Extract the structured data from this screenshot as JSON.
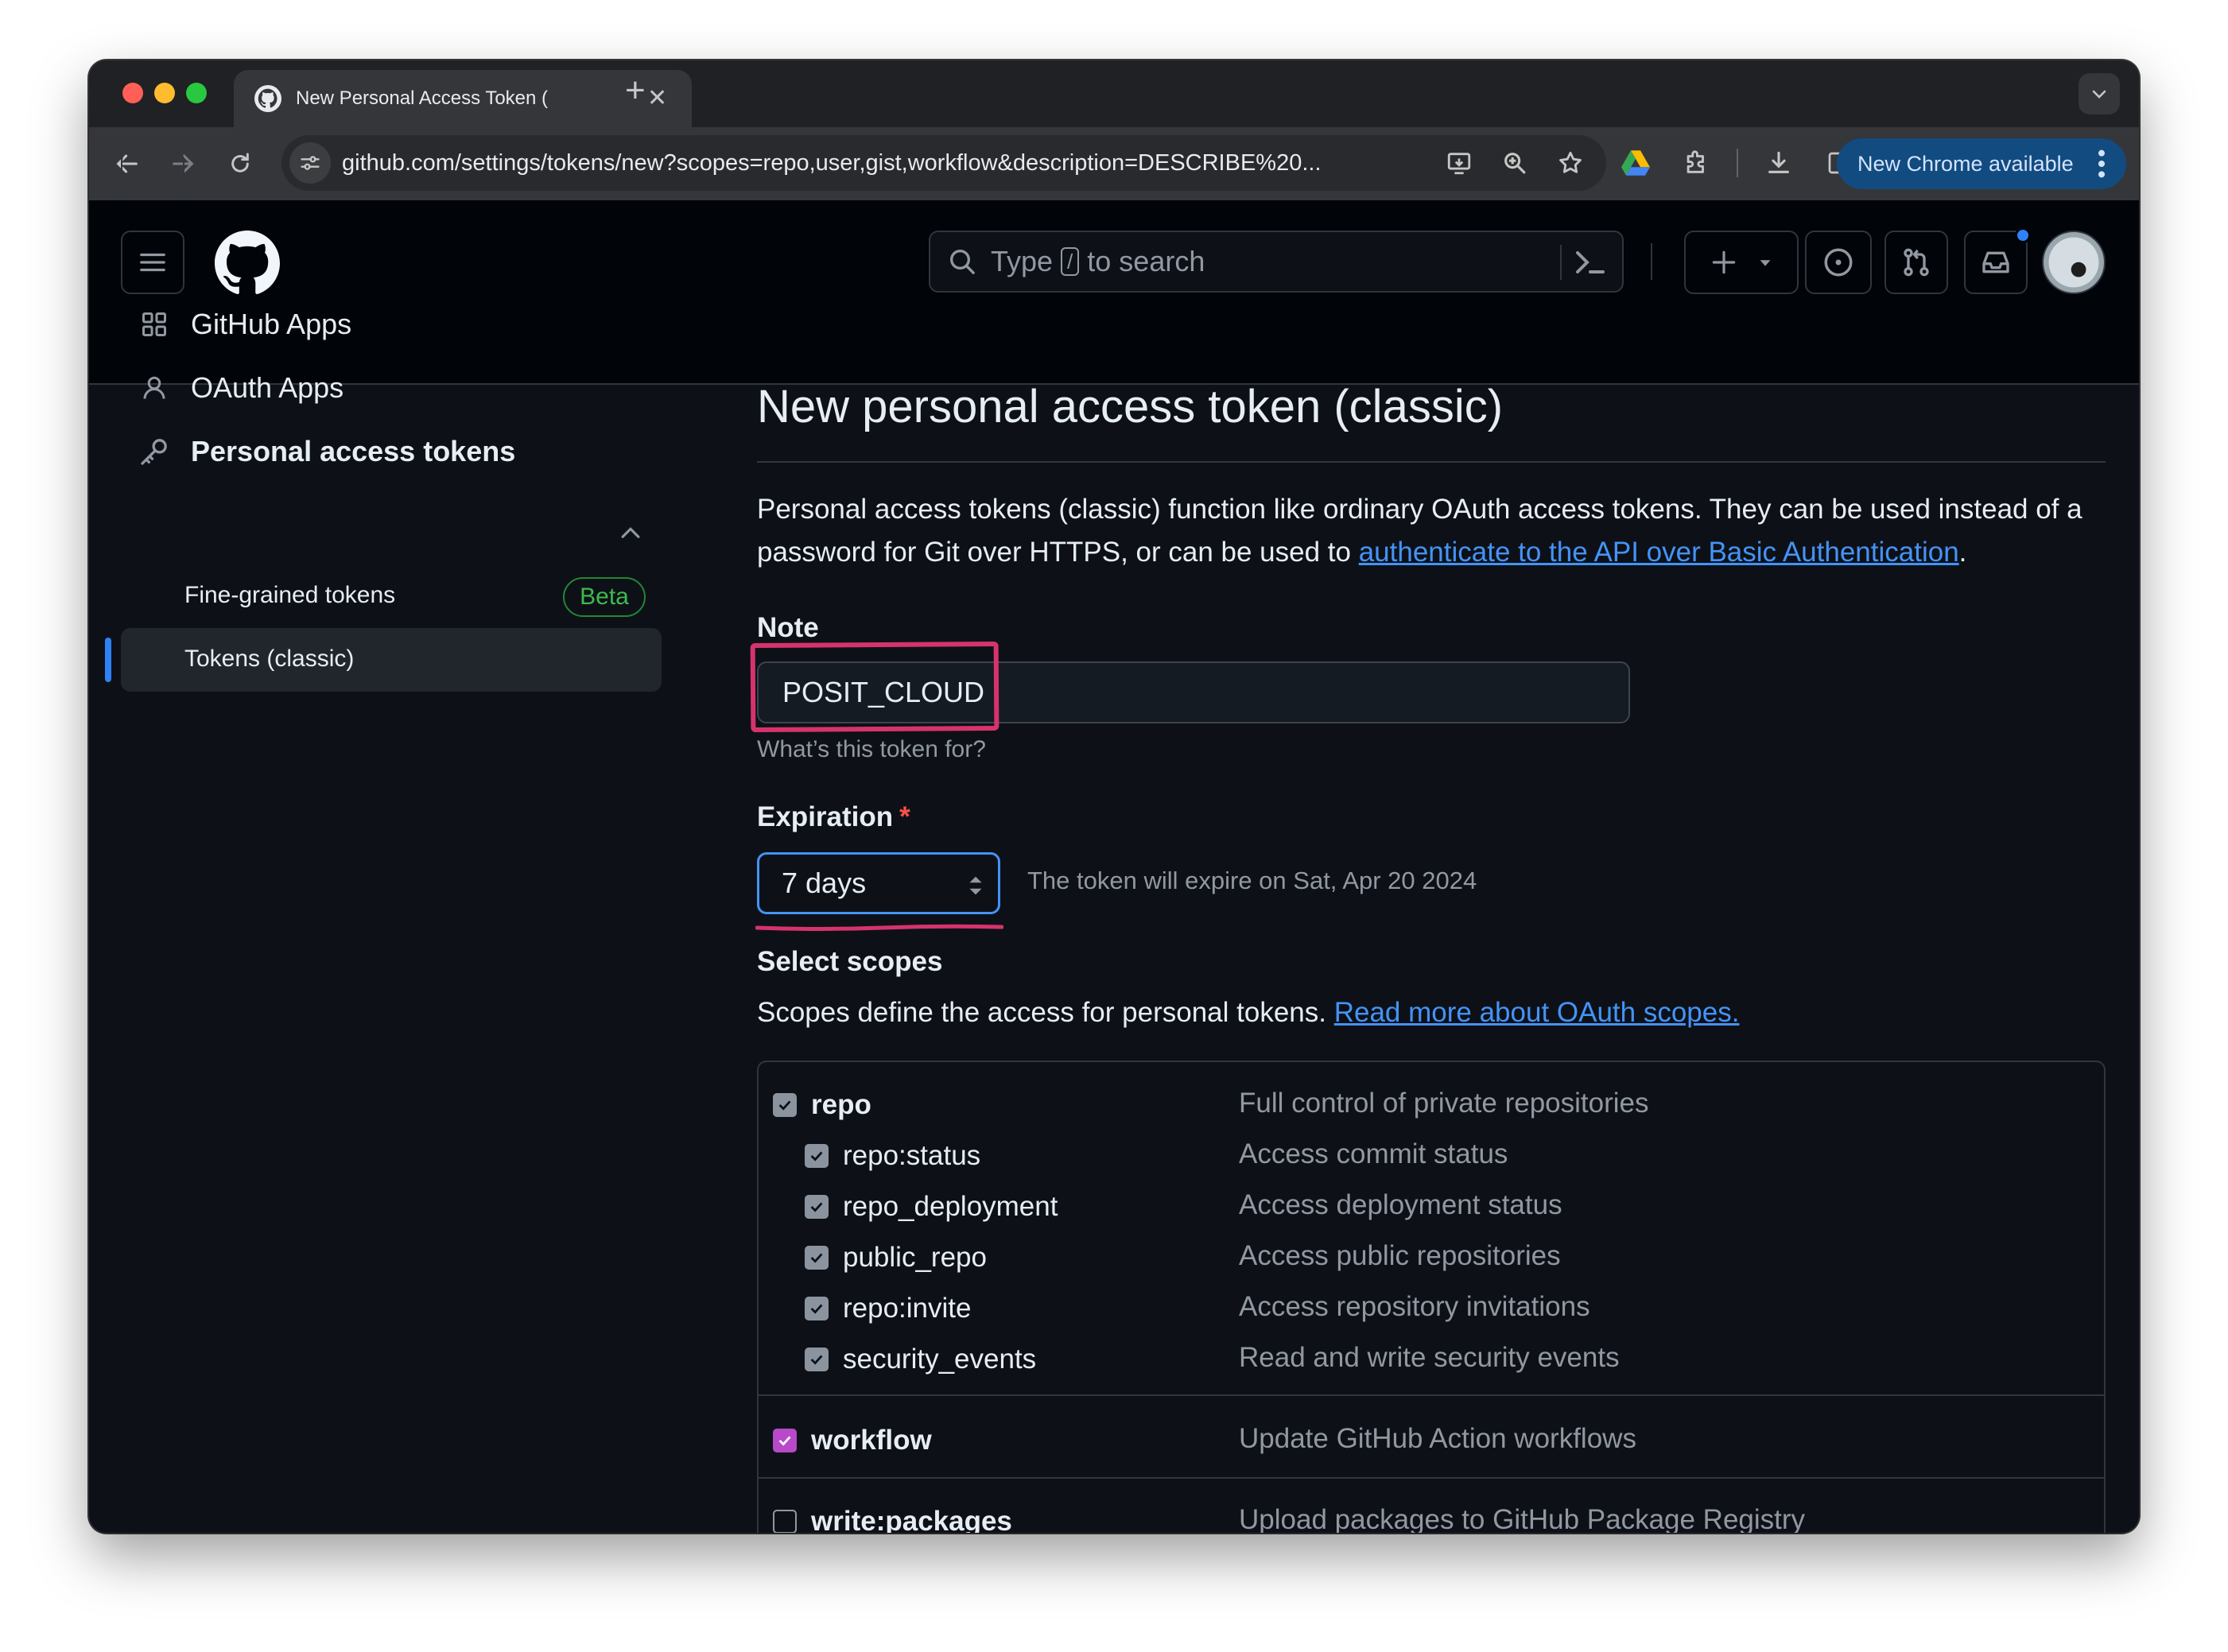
{
  "browser": {
    "tab_title": "New Personal Access Token (",
    "url": "github.com/settings/tokens/new?scopes=repo,user,gist,workflow&description=DESCRIBE%20...",
    "update_button": "New Chrome available"
  },
  "github_header": {
    "search_prefix": "Type",
    "search_key": "/",
    "search_suffix": "to search"
  },
  "sidebar": {
    "items": [
      {
        "label": "GitHub Apps",
        "icon": "apps-grid-icon"
      },
      {
        "label": "OAuth Apps",
        "icon": "person-icon"
      },
      {
        "label": "Personal access tokens",
        "icon": "key-icon"
      }
    ],
    "subitems": [
      {
        "label": "Fine-grained tokens",
        "badge": "Beta"
      },
      {
        "label": "Tokens (classic)",
        "active": true
      }
    ]
  },
  "main": {
    "title": "New personal access token (classic)",
    "intro_text": "Personal access tokens (classic) function like ordinary OAuth access tokens. They can be used instead of a password for Git over HTTPS, or can be used to ",
    "intro_link": "authenticate to the API over Basic Authentication",
    "intro_end": ".",
    "note_label": "Note",
    "note_value": "POSIT_CLOUD",
    "note_hint": "What’s this token for?",
    "expiration_label": "Expiration",
    "expiration_required": "*",
    "expiration_value": "7 days",
    "expiration_text": "The token will expire on Sat, Apr 20 2024",
    "scopes_title": "Select scopes",
    "scopes_desc": "Scopes define the access for personal tokens.",
    "scopes_link": "Read more about OAuth scopes.",
    "scopes": [
      {
        "name": "repo",
        "desc": "Full control of private repositories",
        "checked": true
      },
      {
        "name": "repo:status",
        "desc": "Access commit status",
        "checked": true
      },
      {
        "name": "repo_deployment",
        "desc": "Access deployment status",
        "checked": true
      },
      {
        "name": "public_repo",
        "desc": "Access public repositories",
        "checked": true
      },
      {
        "name": "repo:invite",
        "desc": "Access repository invitations",
        "checked": true
      },
      {
        "name": "security_events",
        "desc": "Read and write security events",
        "checked": true
      },
      {
        "name": "workflow",
        "desc": "Update GitHub Action workflows",
        "checked": true
      },
      {
        "name": "write:packages",
        "desc": "Upload packages to GitHub Package Registry",
        "checked": false
      }
    ]
  },
  "colors": {
    "accent": "#4493f8",
    "highlight": "#d6336c",
    "workflow_check": "#b84ac9",
    "beta_green": "#3fb950"
  }
}
